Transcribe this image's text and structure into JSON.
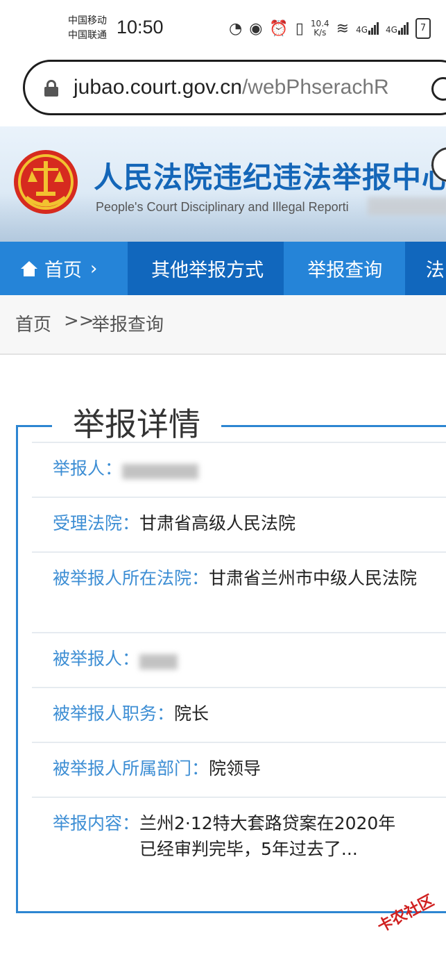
{
  "status_bar": {
    "carrier_1": "中国移动",
    "carrier_2": "中国联通",
    "time": "10:50",
    "net_speed": "10.4",
    "net_unit": "K/s",
    "sig1": "4G",
    "sig2": "4G",
    "battery": "7"
  },
  "browser": {
    "url_host": "jubao.court.gov.cn",
    "url_path": "/webPhserachR"
  },
  "header": {
    "title": "人民法院违纪违法举报中心",
    "subtitle": "People's Court Disciplinary and Illegal Reporti"
  },
  "nav": {
    "home": "首页",
    "other": "其他举报方式",
    "query": "举报查询",
    "more": "法"
  },
  "breadcrumb": {
    "home": "首页",
    "sep": ">>",
    "current": "举报查询"
  },
  "details": {
    "title": "举报详情",
    "rows": [
      {
        "label": "举报人：",
        "value": ""
      },
      {
        "label": "受理法院：",
        "value": "甘肃省高级人民法院"
      },
      {
        "label": "被举报人所在法院：",
        "value": "甘肃省兰州市中级人民法院"
      },
      {
        "label": "被举报人：",
        "value": ""
      },
      {
        "label": "被举报人职务：",
        "value": "院长"
      },
      {
        "label": "被举报人所属部门：",
        "value": "院领导"
      },
      {
        "label": "举报内容：",
        "value": "兰州2·12特大套路贷案在2020年已经审判完毕，5年过去了..."
      }
    ]
  },
  "watermark": "卡农社区",
  "colors": {
    "nav_bg": "#1a78cf",
    "label_blue": "#3d8ed4",
    "title_blue": "#1466b8",
    "card_border": "#2d86d2"
  }
}
